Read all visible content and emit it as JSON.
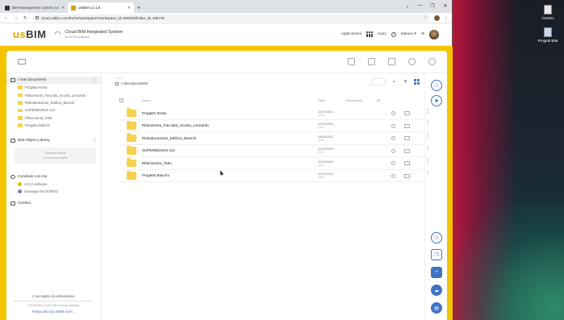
{
  "browser": {
    "tabs": [
      {
        "label": "BIM Management System (usBIM",
        "active": false
      },
      {
        "label": "usBIM v.2.1.8",
        "active": true
      }
    ],
    "new_tab": "+",
    "url": "cloud.usbim.com/home/workspace?workspace_id=295328/folder_id=195746"
  },
  "header": {
    "logo_prefix": "us",
    "logo_suffix": "BIM",
    "title": "Cloud BIM Integrated System",
    "subtitle": "by ACCA software",
    "apps_label": "Applicazioni",
    "help_label": "Aiuto",
    "language": "Italiano"
  },
  "sidebar": {
    "my_docs": "I miei documenti",
    "folders": [
      "Progetto Rossi",
      "Rifacimento_Facciata_Scuola_Leonardo",
      "Ristrutturazione_Edificio_Bianchi",
      "SUPERBONUS 110",
      "Rifacimento_Tetto",
      "Progetto Bianchi"
    ],
    "library": "BIM Object Library",
    "library_empty_1": "Nessuna cartella",
    "library_empty_2": "Crea nuova cartella",
    "shared": "Condivisi con me",
    "shared_items": [
      "ACCA software",
      "Giuseppe Del SORDO"
    ],
    "trash": "Cestino",
    "storage_title": "Il tuo spazio di archiviazione",
    "storage_detail": "223,08 MB di 10,00 GB di spazio utilizzato",
    "storage_fraction": 0.022,
    "upgrade": "Passa alla tua usBIM store..."
  },
  "main": {
    "crumb_home": "• • • •",
    "crumb_current": "I miei documenti",
    "columns": {
      "name": "Nome",
      "date": "Data",
      "size": "Dimensione",
      "vr": "VR"
    },
    "rows": [
      {
        "name": "Progetto Rossi",
        "date": "18/10/2021",
        "time": "11:08"
      },
      {
        "name": "Rifacimento_Facciata_Scuola_Leonardo",
        "date": "07/02/2022",
        "time": "10:21"
      },
      {
        "name": "Ristrutturazione_Edificio_Bianchi",
        "date": "28/09/2022",
        "time": "14:26"
      },
      {
        "name": "SUPERBONUS 110",
        "date": "02/12/2020",
        "time": "12:11"
      },
      {
        "name": "Rifacimento_Tetto",
        "date": "04/03/2022",
        "time": "14:01"
      },
      {
        "name": "Progetto Bianchi",
        "date": "10/11/2022",
        "time": "15:40"
      }
    ]
  },
  "desktop": {
    "icons": [
      "Cestino",
      "Progetti BIM"
    ]
  },
  "colors": {
    "accent": "#f2c500",
    "folder": "#f7d24d",
    "action_blue": "#3f73c4"
  }
}
